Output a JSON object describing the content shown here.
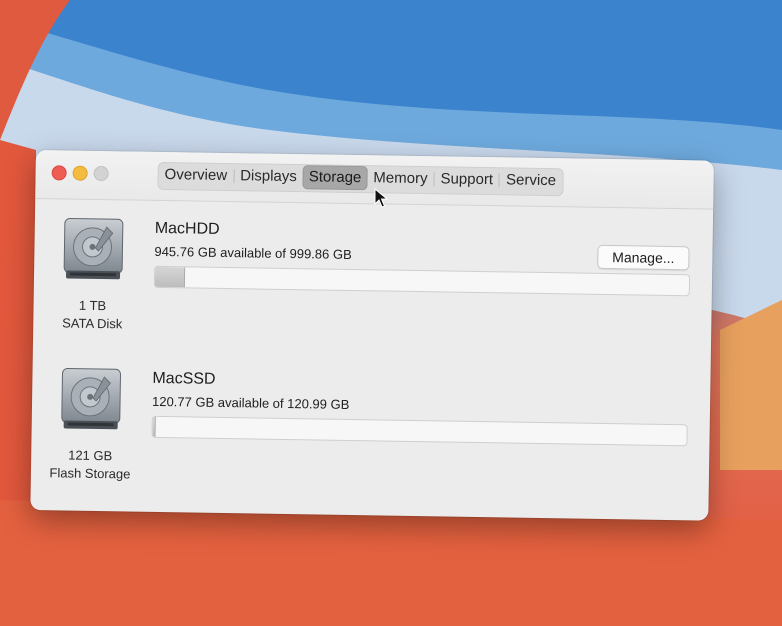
{
  "window": {
    "tabs": [
      {
        "label": "Overview"
      },
      {
        "label": "Displays"
      },
      {
        "label": "Storage",
        "selected": true
      },
      {
        "label": "Memory"
      },
      {
        "label": "Support"
      },
      {
        "label": "Service"
      }
    ]
  },
  "disks": [
    {
      "name": "MacHDD",
      "available_text": "945.76 GB available of 999.86 GB",
      "capacity_label": "1 TB",
      "type_label": "SATA Disk",
      "used_fraction": 0.054,
      "manage_label": "Manage..."
    },
    {
      "name": "MacSSD",
      "available_text": "120.77 GB available of 120.99 GB",
      "capacity_label": "121 GB",
      "type_label": "Flash Storage",
      "used_fraction": 0.002
    }
  ],
  "colors": {
    "close": "#ee5c54",
    "minimize": "#f4bc3f",
    "maximize": "#d3d3d3",
    "selected_tab": "#a7a7a7"
  }
}
